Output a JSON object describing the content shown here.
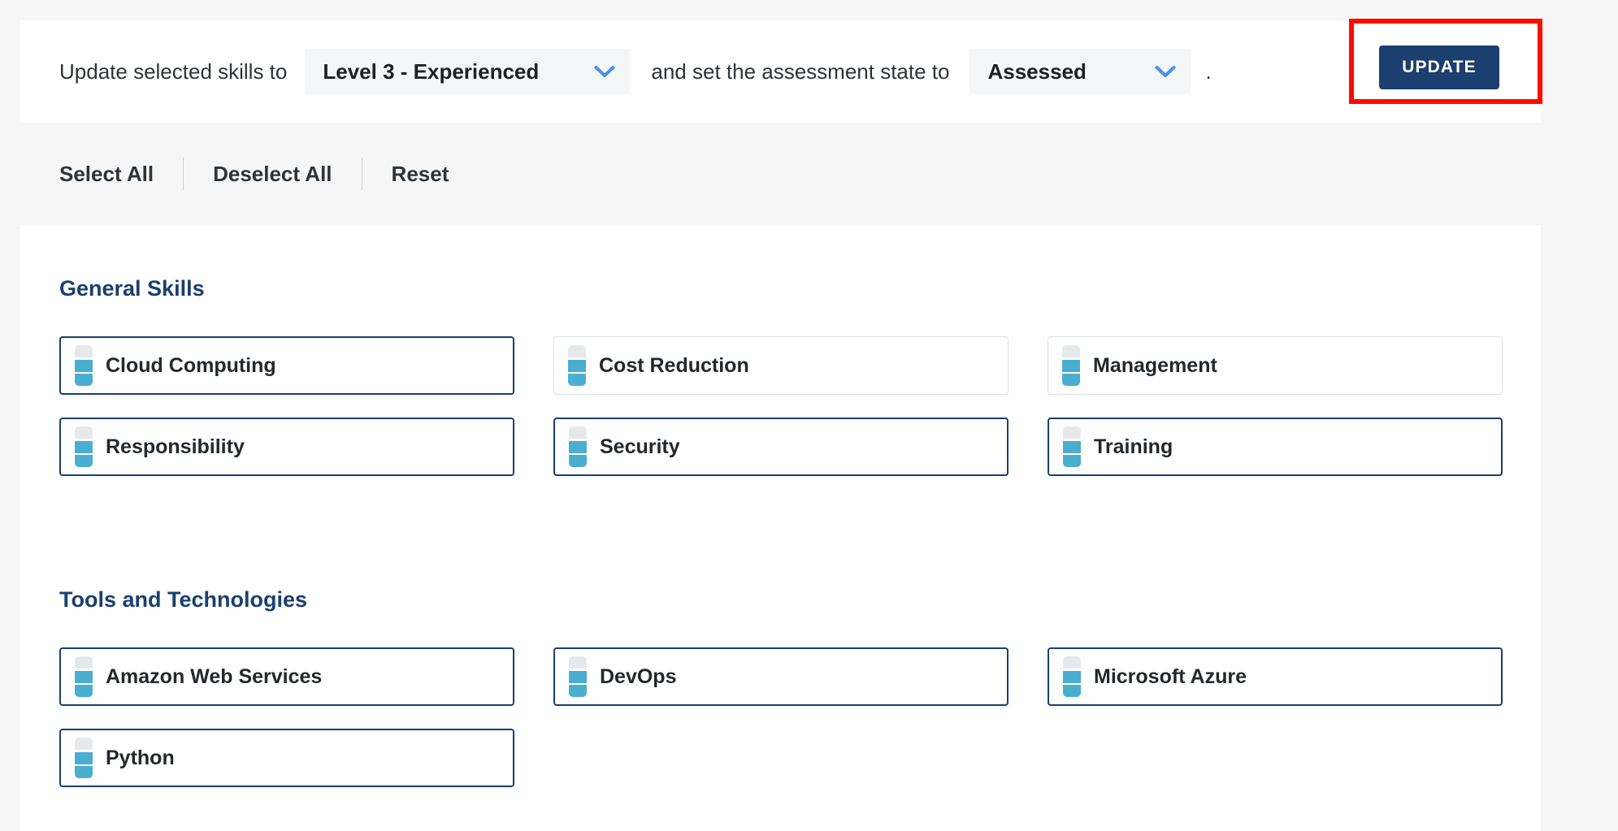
{
  "colors": {
    "page_background": "#f6f6f7",
    "panel_background": "#ffffff",
    "brand_navy": "#1b3f6e",
    "accent_teal": "#4aaed1",
    "chevron_blue": "#4a90e8",
    "highlight_red": "#fc0d00",
    "segment_empty": "#e6e9eb",
    "card_border_unselected": "#dcdfe2"
  },
  "toolbar": {
    "lead_text": "Update selected skills to",
    "level_select": {
      "value": "Level 3 - Experienced",
      "icon": "chevron-down-icon"
    },
    "mid_text": "and set the assessment state to",
    "state_select": {
      "value": "Assessed",
      "icon": "chevron-down-icon"
    },
    "trailing_punctuation": ".",
    "update_label": "UPDATE"
  },
  "actions": {
    "select_all": "Select All",
    "deselect_all": "Deselect All",
    "reset": "Reset"
  },
  "sections": [
    {
      "title": "General Skills",
      "cards": [
        {
          "label": "Cloud Computing",
          "selected": true,
          "level": 2,
          "levels_total": 3
        },
        {
          "label": "Cost Reduction",
          "selected": false,
          "level": 2,
          "levels_total": 3
        },
        {
          "label": "Management",
          "selected": false,
          "level": 2,
          "levels_total": 3
        },
        {
          "label": "Responsibility",
          "selected": true,
          "level": 2,
          "levels_total": 3
        },
        {
          "label": "Security",
          "selected": true,
          "level": 2,
          "levels_total": 3
        },
        {
          "label": "Training",
          "selected": true,
          "level": 2,
          "levels_total": 3
        }
      ]
    },
    {
      "title": "Tools and Technologies",
      "cards": [
        {
          "label": "Amazon Web Services",
          "selected": true,
          "level": 2,
          "levels_total": 3
        },
        {
          "label": "DevOps",
          "selected": true,
          "level": 2,
          "levels_total": 3
        },
        {
          "label": "Microsoft Azure",
          "selected": true,
          "level": 2,
          "levels_total": 3
        },
        {
          "label": "Python",
          "selected": true,
          "level": 2,
          "levels_total": 3
        }
      ]
    }
  ]
}
